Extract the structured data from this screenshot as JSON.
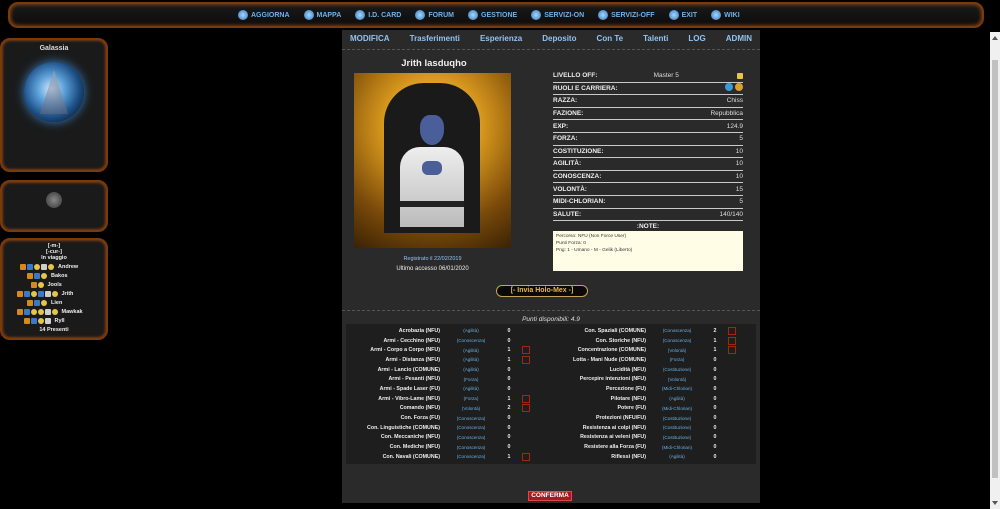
{
  "topnav": [
    {
      "label": "AGGIORNA",
      "icon": "refresh-icon"
    },
    {
      "label": "MAPPA",
      "icon": "map-icon"
    },
    {
      "label": "I.D. CARD",
      "icon": "id-card-icon"
    },
    {
      "label": "FORUM",
      "icon": "forum-icon"
    },
    {
      "label": "GESTIONE",
      "icon": "manage-icon"
    },
    {
      "label": "SERVIZI-ON",
      "icon": "check-icon"
    },
    {
      "label": "SERVIZI-OFF",
      "icon": "services-off-icon"
    },
    {
      "label": "EXIT",
      "icon": "exit-icon"
    },
    {
      "label": "WIKI",
      "icon": "wiki-icon"
    }
  ],
  "sidebar": {
    "galaxy_title": "Galassia",
    "online_header": "[-m-]",
    "online_sub": "[-cur-]",
    "online_state": "In viaggio",
    "users": [
      "Andrew",
      "Bakos",
      "Jools",
      "Jrith",
      "Lien",
      "Mawkak",
      "Ryll"
    ],
    "present": "14 Presenti"
  },
  "tabs": [
    "MODIFICA",
    "Trasferimenti",
    "Esperienza",
    "Deposito",
    "Con Te",
    "Talenti",
    "LOG",
    "ADMIN"
  ],
  "character": {
    "name": "Jrith Iasduqho",
    "registered": "Registrato il 22/02/2019",
    "last_access": "Ultimo accesso 06/01/2020"
  },
  "stats": [
    {
      "k": "LIVELLO OFF:",
      "v": "Master 5"
    },
    {
      "k": "RUOLI E CARRIERA:",
      "v": ""
    },
    {
      "k": "RAZZA:",
      "v": "Chiss"
    },
    {
      "k": "FAZIONE:",
      "v": "Repubblica"
    },
    {
      "k": "EXP:",
      "v": "124.9"
    },
    {
      "k": "FORZA:",
      "v": "5"
    },
    {
      "k": "COSTITUZIONE:",
      "v": "10"
    },
    {
      "k": "AGILITÀ:",
      "v": "10"
    },
    {
      "k": "CONOSCENZA:",
      "v": "10"
    },
    {
      "k": "VOLONTÀ:",
      "v": "15"
    },
    {
      "k": "MIDI-CHLORIAN:",
      "v": "5"
    },
    {
      "k": "SALUTE:",
      "v": "140/140"
    }
  ],
  "notes": {
    "title": ":NOTE:",
    "lines": [
      "Percorso: NFU (Non Force User)",
      "Punti Forza: 0",
      "Png: 1 - Umano - M - Gelik (Liberto)"
    ]
  },
  "holo_button": "[- Invia Holo-Mex -]",
  "points_label": "Punti disponibili: 4.9",
  "skills_left": [
    {
      "n": "Acrobazia (NFU)",
      "s": "(Agilità)",
      "v": "0",
      "b": false
    },
    {
      "n": "Armi - Cecchino (NFU)",
      "s": "(Conoscenza)",
      "v": "0",
      "b": false
    },
    {
      "n": "Armi - Corpo a Corpo (NFU)",
      "s": "(Agilità)",
      "v": "1",
      "b": true
    },
    {
      "n": "Armi - Distanza (NFU)",
      "s": "(Agilità)",
      "v": "1",
      "b": true
    },
    {
      "n": "Armi - Lancio (COMUNE)",
      "s": "(Agilità)",
      "v": "0",
      "b": false
    },
    {
      "n": "Armi - Pesanti (NFU)",
      "s": "(Forza)",
      "v": "0",
      "b": false
    },
    {
      "n": "Armi - Spade Laser (FU)",
      "s": "(Agilità)",
      "v": "0",
      "b": false
    },
    {
      "n": "Armi - Vibro-Lame (NFU)",
      "s": "(Forza)",
      "v": "1",
      "b": true
    },
    {
      "n": "Comando (NFU)",
      "s": "(Volontà)",
      "v": "2",
      "b": true
    },
    {
      "n": "Con. Forza (FU)",
      "s": "(Conoscenza)",
      "v": "0",
      "b": false
    },
    {
      "n": "Con. Linguistiche (COMUNE)",
      "s": "(Conoscenza)",
      "v": "0",
      "b": false
    },
    {
      "n": "Con. Meccaniche (NFU)",
      "s": "(Conoscenza)",
      "v": "0",
      "b": false
    },
    {
      "n": "Con. Mediche (NFU)",
      "s": "(Conoscenza)",
      "v": "0",
      "b": false
    },
    {
      "n": "Con. Navali (COMUNE)",
      "s": "(Conoscenza)",
      "v": "1",
      "b": true
    }
  ],
  "skills_right": [
    {
      "n": "Con. Spaziali (COMUNE)",
      "s": "(Conoscenza)",
      "v": "2",
      "b": true
    },
    {
      "n": "Con. Storiche (NFU)",
      "s": "(Conoscenza)",
      "v": "1",
      "b": true
    },
    {
      "n": "Concentrazione (COMUNE)",
      "s": "(Volontà)",
      "v": "1",
      "b": true
    },
    {
      "n": "Lotta - Mani Nude (COMUNE)",
      "s": "(Forza)",
      "v": "0",
      "b": false
    },
    {
      "n": "Lucidità (NFU)",
      "s": "(Costituzione)",
      "v": "0",
      "b": false
    },
    {
      "n": "Percepire intenzioni (NFU)",
      "s": "(Volontà)",
      "v": "0",
      "b": false
    },
    {
      "n": "Percezione (FU)",
      "s": "(Midi-Chlorian)",
      "v": "0",
      "b": false
    },
    {
      "n": "Pilotare (NFU)",
      "s": "(Agilità)",
      "v": "0",
      "b": false
    },
    {
      "n": "Potere (FU)",
      "s": "(Midi-Chlorian)",
      "v": "0",
      "b": false
    },
    {
      "n": "Protezioni (NFU/FU)",
      "s": "(Costituzione)",
      "v": "0",
      "b": false
    },
    {
      "n": "Resistenza ai colpi (NFU)",
      "s": "(Costituzione)",
      "v": "0",
      "b": false
    },
    {
      "n": "Resistenza ai veleni (NFU)",
      "s": "(Costituzione)",
      "v": "0",
      "b": false
    },
    {
      "n": "Resistere alla Forza (FU)",
      "s": "(Midi-Chlorian)",
      "v": "0",
      "b": false
    },
    {
      "n": "Riflessi (NFU)",
      "s": "(Agilità)",
      "v": "0",
      "b": false
    }
  ],
  "confirm_label": "CONFERMA"
}
